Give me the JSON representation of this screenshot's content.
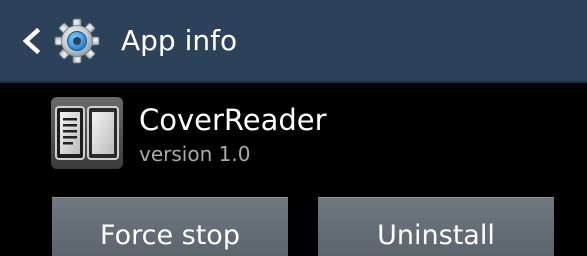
{
  "action_bar": {
    "title": "App info",
    "back_icon": "chevron-left-icon",
    "settings_icon": "gear-icon",
    "background": "#2c4259"
  },
  "app": {
    "name": "CoverReader",
    "version": "version 1.0",
    "icon": "reader-app-icon"
  },
  "buttons": {
    "force_stop": "Force stop",
    "uninstall": "Uninstall"
  }
}
